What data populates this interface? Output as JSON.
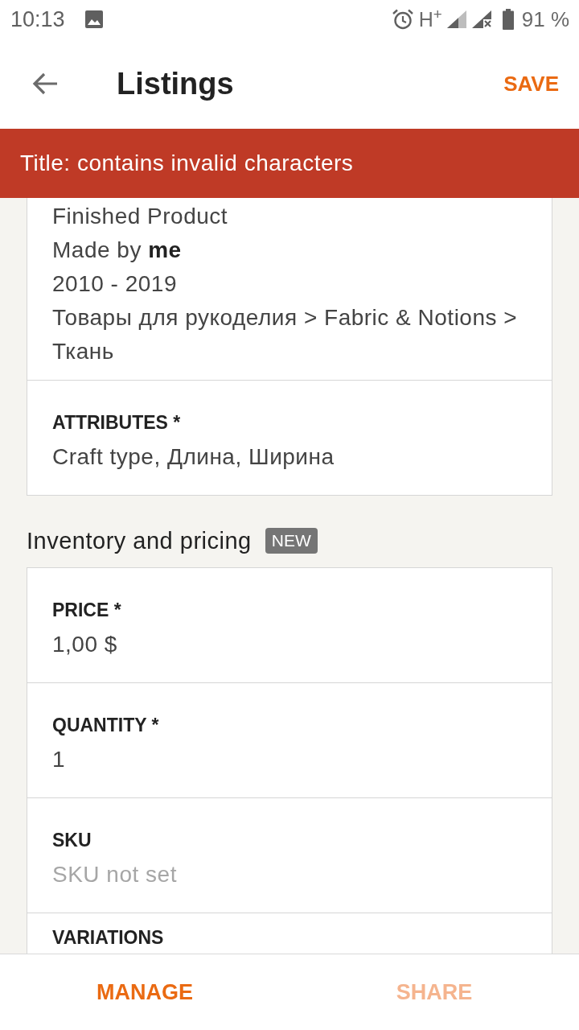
{
  "status_bar": {
    "time": "10:13",
    "network": "H$^{+}$",
    "battery": "91 %"
  },
  "app_bar": {
    "title": "Listings",
    "action": "SAVE"
  },
  "error_banner": {
    "message": "Title: contains invalid characters"
  },
  "details_card": {
    "summary_lines": [
      "Finished Product",
      "Made by **me**",
      "2010 - 2019",
      "Товары для рукоделия > Fabric & Notions > Ткань"
    ],
    "fields": [
      {
        "label": "ATTRIBUTES *",
        "value": "Craft type, Длина, Ширина",
        "is_set": true
      }
    ]
  },
  "inventory": {
    "heading": "Inventory and pricing",
    "badge": "NEW",
    "fields": [
      {
        "label": "PRICE *",
        "value": "1,00 $",
        "is_set": true
      },
      {
        "label": "QUANTITY *",
        "value": "1",
        "is_set": true
      },
      {
        "label": "SKU",
        "value": "SKU not set",
        "is_set": false
      }
    ],
    "next_field": {
      "label": "VARIATIONS"
    }
  },
  "bottom_bar": {
    "buttons": [
      {
        "label": "MANAGE",
        "disabled": false
      },
      {
        "label": "SHARE",
        "disabled": true
      }
    ]
  }
}
